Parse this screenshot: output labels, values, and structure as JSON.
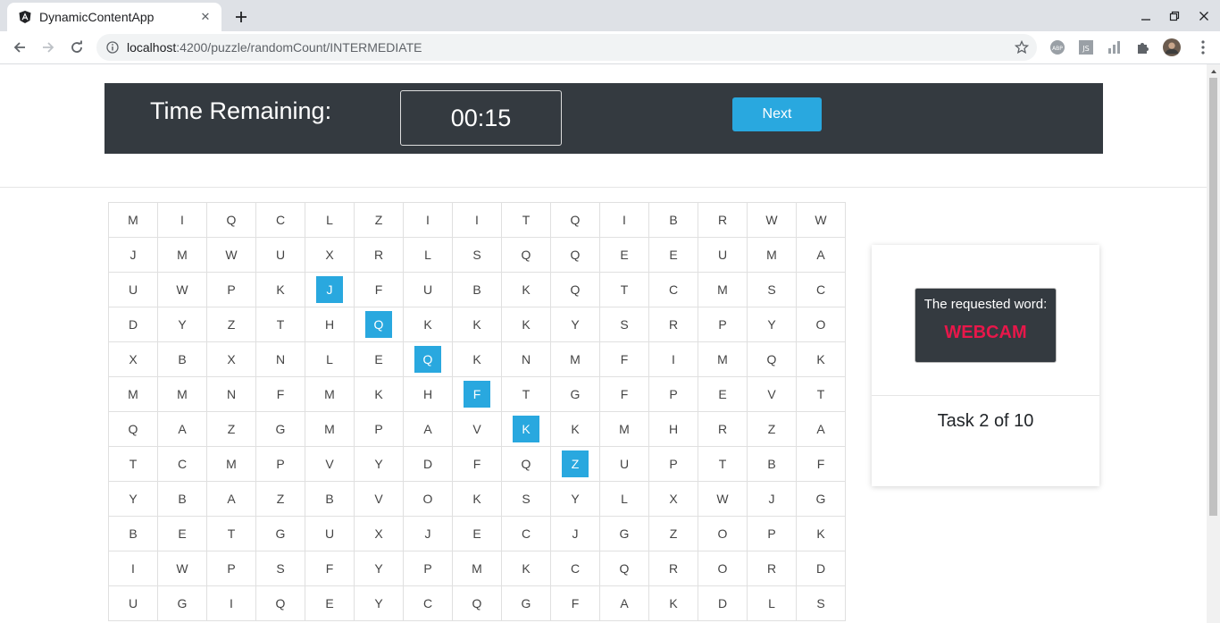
{
  "browser": {
    "tab_title": "DynamicContentApp",
    "url_host": "localhost",
    "url_rest": ":4200/puzzle/randomCount/INTERMEDIATE"
  },
  "header": {
    "timer_label": "Time Remaining:",
    "timer_value": "00:15",
    "next_label": "Next"
  },
  "grid": {
    "rows": [
      [
        "M",
        "I",
        "Q",
        "C",
        "L",
        "Z",
        "I",
        "I",
        "T",
        "Q",
        "I",
        "B",
        "R",
        "W",
        "W"
      ],
      [
        "J",
        "M",
        "W",
        "U",
        "X",
        "R",
        "L",
        "S",
        "Q",
        "Q",
        "E",
        "E",
        "U",
        "M",
        "A"
      ],
      [
        "U",
        "W",
        "P",
        "K",
        "J",
        "F",
        "U",
        "B",
        "K",
        "Q",
        "T",
        "C",
        "M",
        "S",
        "C"
      ],
      [
        "D",
        "Y",
        "Z",
        "T",
        "H",
        "Q",
        "K",
        "K",
        "K",
        "Y",
        "S",
        "R",
        "P",
        "Y",
        "O"
      ],
      [
        "X",
        "B",
        "X",
        "N",
        "L",
        "E",
        "Q",
        "K",
        "N",
        "M",
        "F",
        "I",
        "M",
        "Q",
        "K"
      ],
      [
        "M",
        "M",
        "N",
        "F",
        "M",
        "K",
        "H",
        "F",
        "T",
        "G",
        "F",
        "P",
        "E",
        "V",
        "T"
      ],
      [
        "Q",
        "A",
        "Z",
        "G",
        "M",
        "P",
        "A",
        "V",
        "K",
        "K",
        "M",
        "H",
        "R",
        "Z",
        "A"
      ],
      [
        "T",
        "C",
        "M",
        "P",
        "V",
        "Y",
        "D",
        "F",
        "Q",
        "Z",
        "U",
        "P",
        "T",
        "B",
        "F"
      ],
      [
        "Y",
        "B",
        "A",
        "Z",
        "B",
        "V",
        "O",
        "K",
        "S",
        "Y",
        "L",
        "X",
        "W",
        "J",
        "G"
      ],
      [
        "B",
        "E",
        "T",
        "G",
        "U",
        "X",
        "J",
        "E",
        "C",
        "J",
        "G",
        "Z",
        "O",
        "P",
        "K"
      ],
      [
        "I",
        "W",
        "P",
        "S",
        "F",
        "Y",
        "P",
        "M",
        "K",
        "C",
        "Q",
        "R",
        "O",
        "R",
        "D"
      ],
      [
        "U",
        "G",
        "I",
        "Q",
        "E",
        "Y",
        "C",
        "Q",
        "G",
        "F",
        "A",
        "K",
        "D",
        "L",
        "S"
      ]
    ],
    "selected": [
      [
        2,
        4
      ],
      [
        3,
        5
      ],
      [
        4,
        6
      ],
      [
        5,
        7
      ],
      [
        6,
        8
      ],
      [
        7,
        9
      ]
    ]
  },
  "task": {
    "word_label": "The requested word:",
    "word": "WEBCAM",
    "progress": "Task 2 of 10"
  },
  "colors": {
    "dark": "#343a40",
    "accent": "#29a8df",
    "word": "#e8174a"
  }
}
